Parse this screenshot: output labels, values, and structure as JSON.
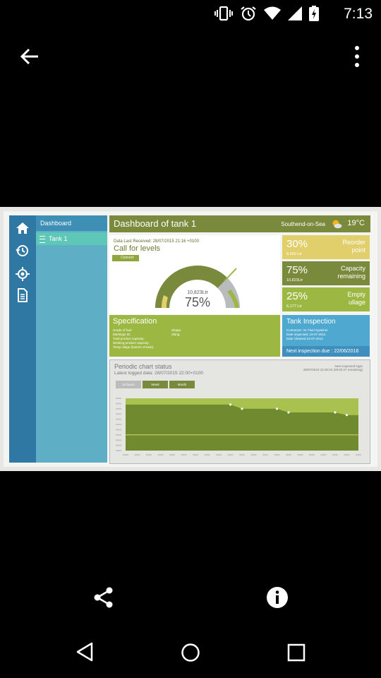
{
  "status_bar": {
    "time": "7:13"
  },
  "sidebar_nav": {
    "dashboard": "Dashboard",
    "tank": "Tank 1"
  },
  "header": {
    "title": "Dashboard of tank 1",
    "location": "Southend-on-Sea",
    "temperature": "19°C"
  },
  "levels": {
    "data_received": "Data Last Received: 28/07/2015 21:16 +0100",
    "title": "Call for levels",
    "connect": "Connect",
    "gauge_value": "10,823Ltr",
    "gauge_pct": "75%",
    "fill_fraction": 0.75
  },
  "stats": [
    {
      "pct": "30%",
      "sub": "8,900 Ltr",
      "label1": "Reorder",
      "label2": "point",
      "color": "#e0cf6a"
    },
    {
      "pct": "75%",
      "sub": "10,823Ltr",
      "label1": "Capacity",
      "label2": "remaining",
      "color": "#7a8a3c"
    },
    {
      "pct": "25%",
      "sub": "6,177 Ltr",
      "label1": "Empty",
      "label2": "ullage",
      "color": "#9db842"
    }
  ],
  "specification": {
    "title": "Specification",
    "left": [
      "Grade of fuel:",
      "Markings ID:",
      "Total product capacity:",
      "Working product capacity:",
      "Temp ullage (bottom of tank):"
    ],
    "right": [
      "Shape:",
      "Siting:"
    ]
  },
  "tank_inspection": {
    "title": "Tank Inspection",
    "rows": [
      "Contractor: Air Fluid Systems",
      "Date inspected: 23-07-2014",
      "Date Cleaned 23-07-2014"
    ],
    "next": "Next inspection due : 22/06/2016"
  },
  "chart": {
    "title": "Periodic chart status",
    "latest": "Latest logged data: 28/07/2015 22:00+0100",
    "right_line1": "Next expected login",
    "right_line2": "28/07/2015 22:30:03 (29:00:27 remaining)",
    "buttons": [
      "24 hours",
      "Week",
      "Month"
    ]
  },
  "chart_data": {
    "type": "area",
    "title": "Periodic chart status",
    "x_count": 21,
    "series": [
      {
        "values": [
          100,
          100,
          100,
          100,
          100,
          100,
          100,
          100,
          100,
          100,
          100,
          100,
          100,
          100,
          100,
          100,
          100,
          100,
          100,
          100,
          100
        ]
      },
      {
        "values": [
          88,
          88,
          88,
          88,
          88,
          88,
          88,
          88,
          88,
          88,
          80,
          80,
          80,
          80,
          73,
          73,
          73,
          73,
          73,
          68,
          68
        ]
      },
      {
        "values": [
          30,
          30,
          30,
          30,
          30,
          30,
          30,
          30,
          30,
          30,
          30,
          30,
          30,
          30,
          30,
          30,
          30,
          30,
          30,
          30,
          30
        ]
      }
    ],
    "ylim": [
      0,
      100
    ],
    "colors": {
      "capacity": "#a9c24f",
      "level": "#6f8a2f",
      "reorder_line": "#d9d463"
    }
  }
}
